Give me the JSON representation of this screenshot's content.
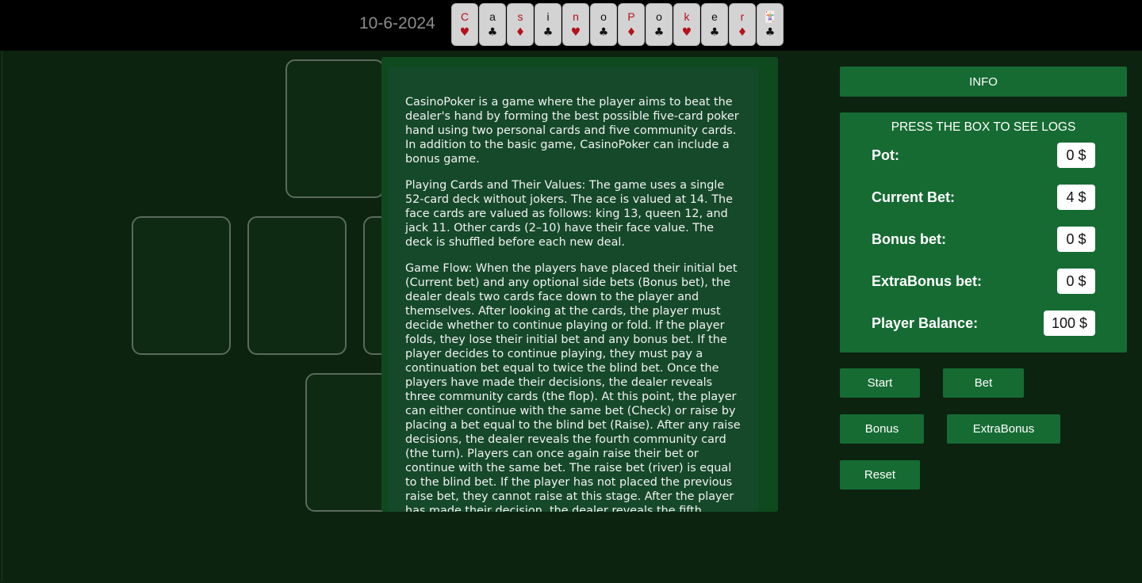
{
  "header": {
    "date": "10-6-2024",
    "title_cards": [
      {
        "letter": "C",
        "suit": "♥",
        "color": "red"
      },
      {
        "letter": "a",
        "suit": "♣",
        "color": "black"
      },
      {
        "letter": "s",
        "suit": "♦",
        "color": "red"
      },
      {
        "letter": "i",
        "suit": "♣",
        "color": "black"
      },
      {
        "letter": "n",
        "suit": "♥",
        "color": "red"
      },
      {
        "letter": "o",
        "suit": "♣",
        "color": "black"
      },
      {
        "letter": "P",
        "suit": "♦",
        "color": "red"
      },
      {
        "letter": "o",
        "suit": "♣",
        "color": "black"
      },
      {
        "letter": "k",
        "suit": "♥",
        "color": "red"
      },
      {
        "letter": "e",
        "suit": "♣",
        "color": "black"
      },
      {
        "letter": "r",
        "suit": "♦",
        "color": "red"
      },
      {
        "letter": "🃏",
        "suit": "♣",
        "color": "black"
      }
    ]
  },
  "info_modal": {
    "paragraphs": [
      "CasinoPoker is a game where the player aims to beat the dealer's hand by forming the best possible five-card poker hand using two personal cards and five community cards. In addition to the basic game, CasinoPoker can include a bonus game.",
      "Playing Cards and Their Values: The game uses a single 52-card deck without jokers. The ace is valued at 14. The face cards are valued as follows: king 13, queen 12, and jack 11. Other cards (2–10) have their face value. The deck is shuffled before each new deal.",
      "Game Flow: When the players have placed their initial bet (Current bet) and any optional side bets (Bonus bet), the dealer deals two cards face down to the player and themselves. After looking at the cards, the player must decide whether to continue playing or fold. If the player folds, they lose their initial bet and any bonus bet. If the player decides to continue playing, they must pay a continuation bet equal to twice the blind bet. Once the players have made their decisions, the dealer reveals three community cards (the flop). At this point, the player can either continue with the same bet (Check) or raise by placing a bet equal to the blind bet (Raise). After any raise decisions, the dealer reveals the fourth community card (the turn). Players can once again raise their bet or continue with the same bet. The raise bet (river) is equal to the blind bet. If the player has not placed the previous raise bet, they cannot raise at this stage. After the player has made their decision, the dealer reveals the fifth"
    ]
  },
  "info_button": "INFO",
  "stats": {
    "header": "PRESS THE BOX TO SEE LOGS",
    "pot": {
      "label": "Pot:",
      "value": "0 $"
    },
    "current_bet": {
      "label": "Current Bet:",
      "value": "4 $"
    },
    "bonus_bet": {
      "label": "Bonus bet:",
      "value": "0 $"
    },
    "extrabonus_bet": {
      "label": "ExtraBonus bet:",
      "value": "0 $"
    },
    "player_balance": {
      "label": "Player Balance:",
      "value": "100 $"
    }
  },
  "buttons": {
    "start": "Start",
    "bet": "Bet",
    "bonus": "Bonus",
    "extrabonus": "ExtraBonus",
    "reset": "Reset"
  },
  "colors": {
    "table": "#0c2310",
    "accent": "#166b33",
    "modal": "#15492a"
  }
}
